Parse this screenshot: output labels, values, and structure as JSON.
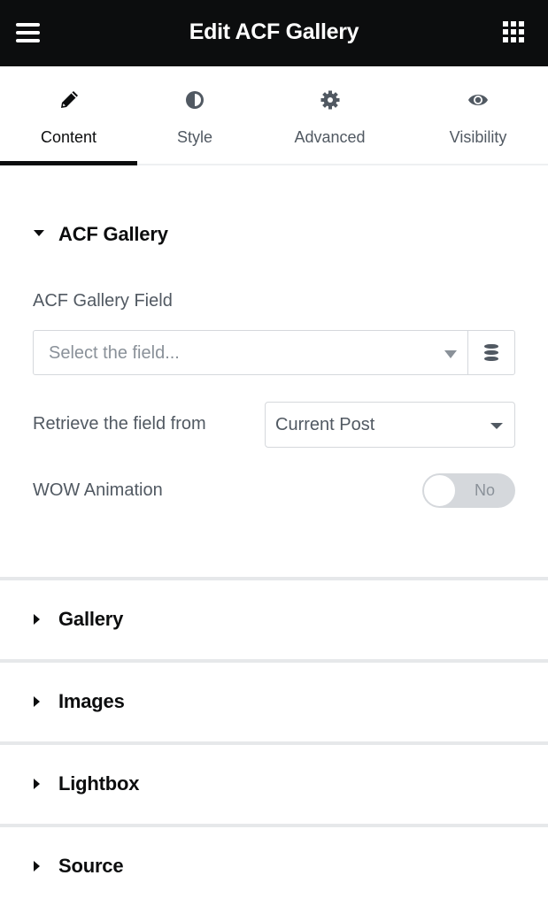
{
  "header": {
    "title": "Edit ACF Gallery",
    "menu_icon": "hamburger-icon",
    "apps_icon": "grid-icon"
  },
  "tabs": [
    {
      "label": "Content",
      "icon": "pencil-icon",
      "active": true
    },
    {
      "label": "Style",
      "icon": "half-circle-icon",
      "active": false
    },
    {
      "label": "Advanced",
      "icon": "gear-icon",
      "active": false
    },
    {
      "label": "Visibility",
      "icon": "eye-icon",
      "active": false
    }
  ],
  "acf_section": {
    "title": "ACF Gallery",
    "expanded": true,
    "gallery_field": {
      "label": "ACF Gallery Field",
      "placeholder": "Select the field...",
      "dynamic_icon": "database-icon"
    },
    "retrieve_from": {
      "label": "Retrieve the field from",
      "value": "Current Post"
    },
    "wow_animation": {
      "label": "WOW Animation",
      "value": "No",
      "enabled": false
    }
  },
  "collapsed_sections": [
    {
      "title": "Gallery"
    },
    {
      "title": "Images"
    },
    {
      "title": "Lightbox"
    },
    {
      "title": "Source"
    }
  ],
  "colors": {
    "header_bg": "#0c0d0e",
    "text_dark": "#0c0d0e",
    "text_muted": "#515962",
    "border": "#d5d8dc"
  }
}
